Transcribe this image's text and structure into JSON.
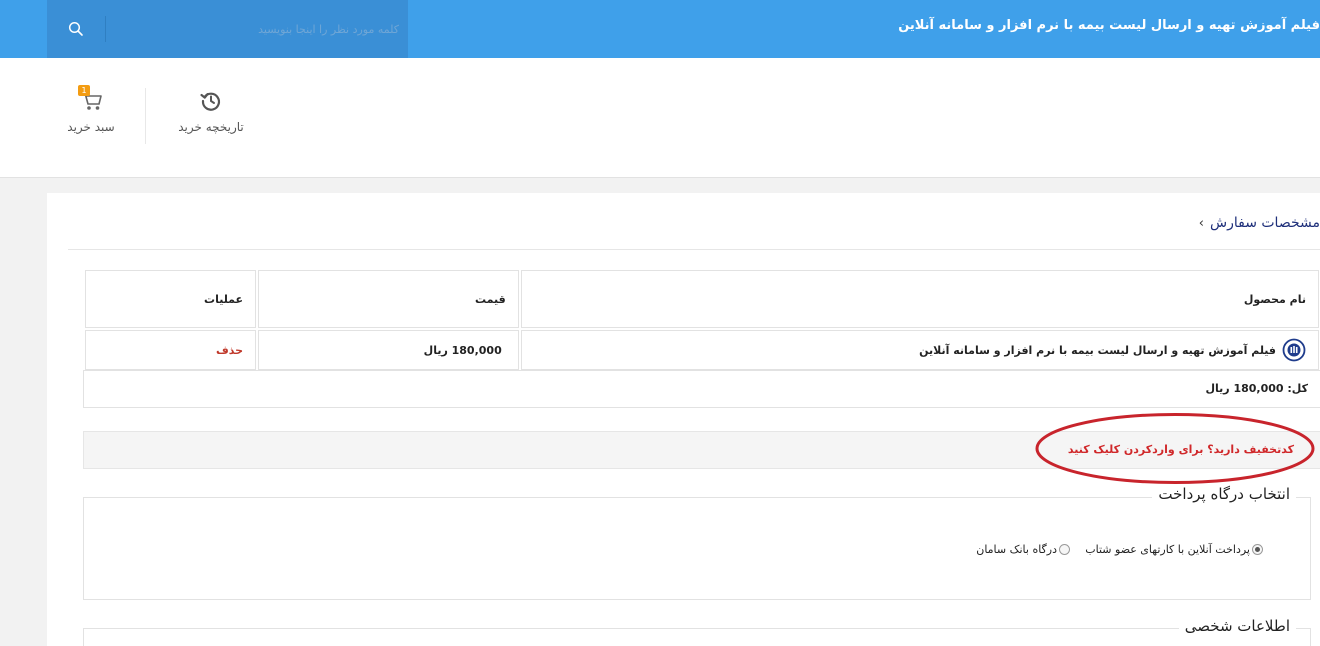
{
  "topbar": {
    "site_title": "فیلم آموزش تهیه و ارسال لیست بیمه با نرم افزار و سامانه آنلاین",
    "search_placeholder": "کلمه مورد نظر را اینجا بنویسید",
    "search_icon": "search-icon"
  },
  "header": {
    "history_label": "تاریخچه خرید",
    "history_icon": "history-icon",
    "cart_label": "سبد خرید",
    "cart_icon": "cart-icon",
    "cart_count": "1"
  },
  "order": {
    "title": "مشخصات سفارش",
    "columns": {
      "name": "نام محصول",
      "price": "قیمت",
      "ops": "عملیات"
    },
    "rows": [
      {
        "name": "فیلم آموزش تهیه و ارسال لیست بیمه با نرم افزار و سامانه آنلاین",
        "price": "180,000 ریال",
        "delete": "حذف"
      }
    ],
    "total": "کل: 180,000 ریال"
  },
  "discount": {
    "text": "کدتخفیف دارید؟ برای واردکردن کلیک کنید"
  },
  "gateway": {
    "title": "انتخاب درگاه پرداخت",
    "options": [
      {
        "label": "پرداخت آنلاین با کارتهای عضو شتاب",
        "selected": true
      },
      {
        "label": "درگاه بانک سامان",
        "selected": false
      }
    ]
  },
  "personal": {
    "title": "اطلاعات شخصی"
  },
  "colors": {
    "topbar": "#3fa0ea",
    "search_bg": "#3a8fd6",
    "title_blue": "#1e2f7a",
    "delete_red": "#c0392b",
    "annotation_red": "#c8242c",
    "badge": "#f39c12"
  }
}
